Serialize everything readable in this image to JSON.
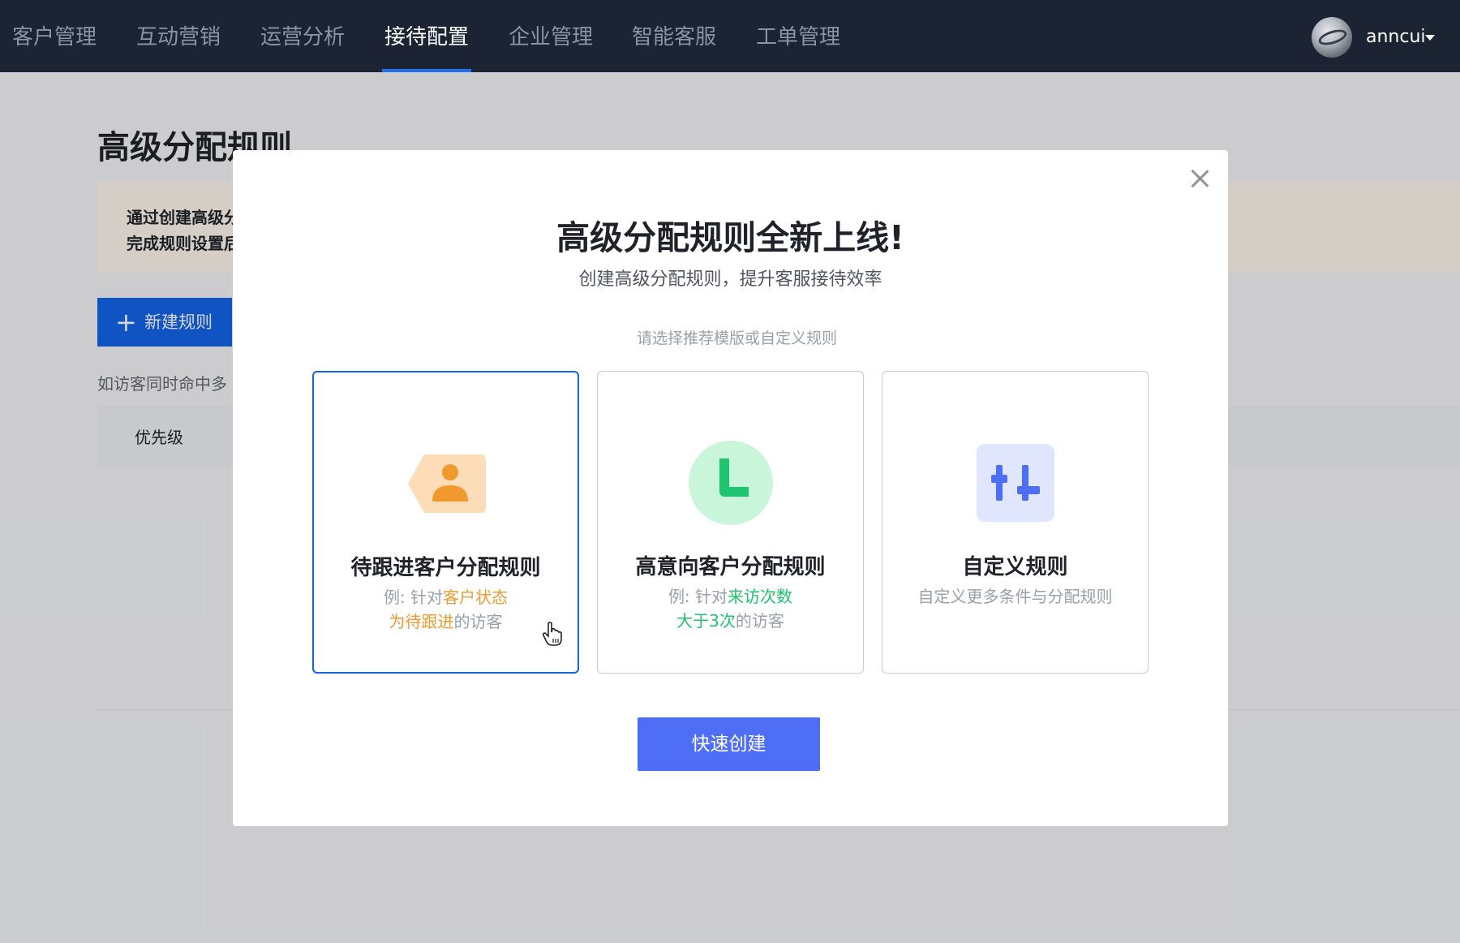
{
  "nav": {
    "items": [
      "客户管理",
      "互动营销",
      "运营分析",
      "接待配置",
      "企业管理",
      "智能客服",
      "工单管理"
    ],
    "active_index": 3,
    "username": "anncui"
  },
  "page": {
    "title": "高级分配规则",
    "notice_lines": [
      "通过创建高级分",
      "完成规则设置后"
    ],
    "new_rule_button": "新建规则",
    "hint": "如访客同时命中多",
    "table_header": "优先级"
  },
  "modal": {
    "title": "高级分配规则全新上线!",
    "subtitle": "创建高级分配规则，提升客服接待效率",
    "choose_hint": "请选择推荐模版或自定义规则",
    "cards": [
      {
        "title": "待跟进客户分配规则",
        "desc_prefix": "例: 针对",
        "desc_highlight_1": "客户状态",
        "desc_highlight_2": "为待跟进",
        "desc_suffix": "的访客",
        "icon": "person-icon",
        "selected": true
      },
      {
        "title": "高意向客户分配规则",
        "desc_prefix": "例: 针对",
        "desc_highlight_1": "来访次数",
        "desc_highlight_2": "大于3次",
        "desc_suffix": "的访客",
        "icon": "clock-icon",
        "selected": false
      },
      {
        "title": "自定义规则",
        "desc": "自定义更多条件与分配规则",
        "icon": "sliders-icon",
        "selected": false
      }
    ],
    "create_button": "快速创建"
  },
  "colors": {
    "nav_bg": "#1c2433",
    "primary": "#1464e8",
    "create_button": "#4d6ef5",
    "orange": "#f0992e",
    "green": "#1fc46e"
  }
}
